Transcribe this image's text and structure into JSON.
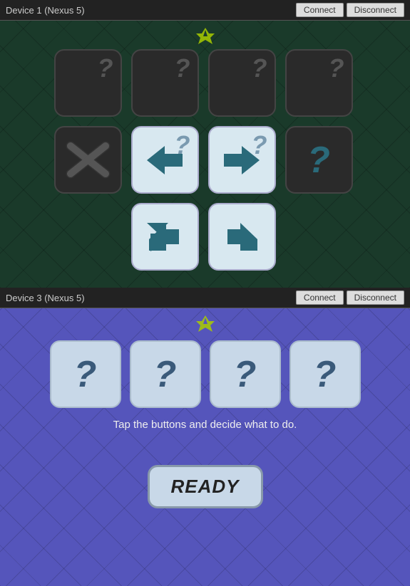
{
  "device1": {
    "title": "Device 1 (Nexus 5)",
    "connect_label": "Connect",
    "disconnect_label": "Disconnect"
  },
  "device2": {
    "title": "Device 3 (Nexus 5)",
    "connect_label": "Connect",
    "disconnect_label": "Disconnect",
    "tap_text": "Tap the buttons and decide what to do.",
    "ready_label": "READY"
  },
  "cards_row1": [
    "?",
    "?",
    "?",
    "?"
  ],
  "cards_row2": [
    "x",
    "arrow-left",
    "arrow-right",
    "?"
  ],
  "cards_row3": [
    "arrow-down-left",
    "arrow-down-right"
  ],
  "cards_device2": [
    "?",
    "?",
    "?",
    "?"
  ]
}
